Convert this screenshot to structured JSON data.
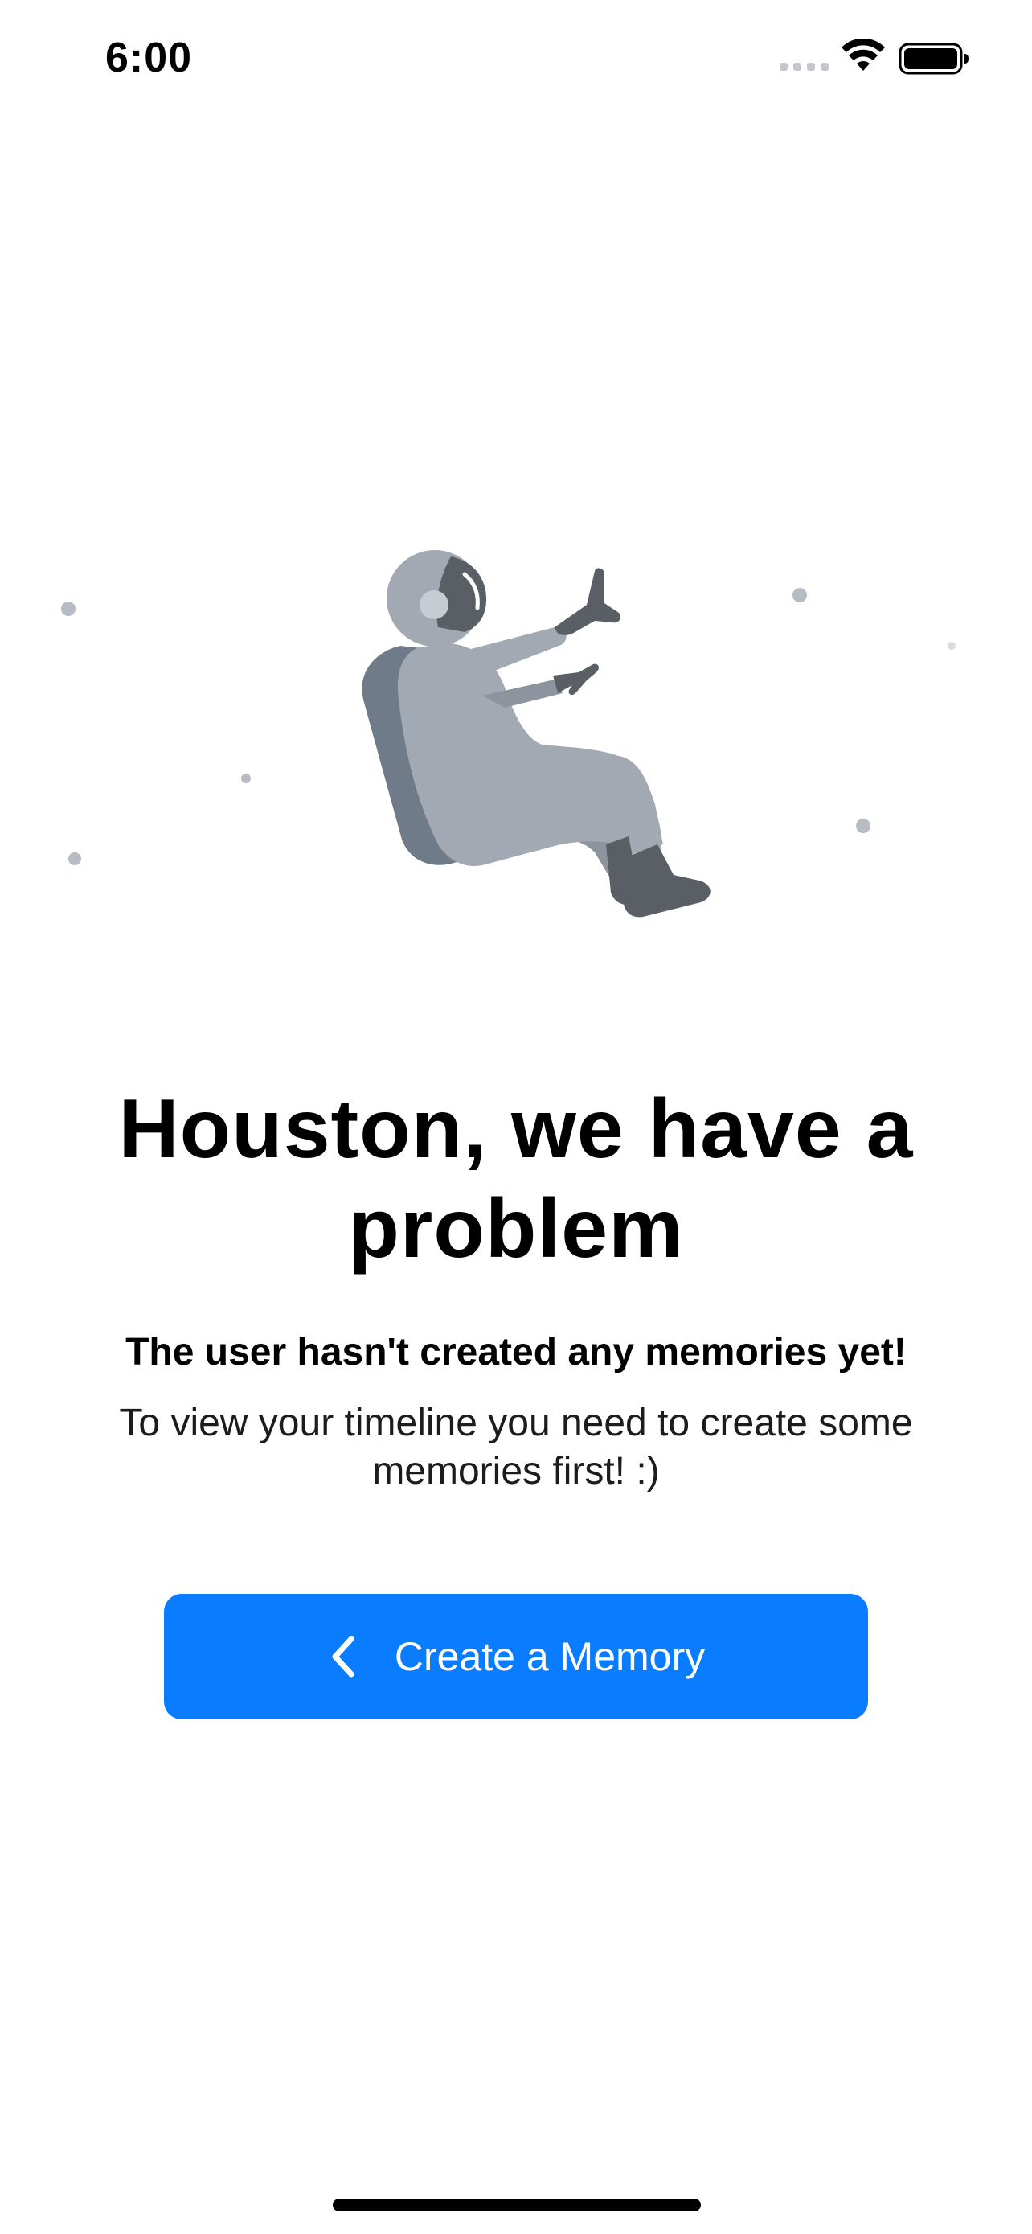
{
  "status_bar": {
    "time": "6:00"
  },
  "empty_state": {
    "headline": "Houston, we have a problem",
    "subhead": "The user hasn't created any memories yet!",
    "body": "To view your timeline you need to create some memories first! :)"
  },
  "actions": {
    "create_memory_label": "Create a Memory",
    "create_memory_icon": "chevron-left-icon"
  },
  "colors": {
    "accent": "#0a7cff",
    "illustration_light": "#a3a9b3",
    "illustration_dark": "#6f7b88",
    "illustration_darkest": "#5a5f65"
  }
}
